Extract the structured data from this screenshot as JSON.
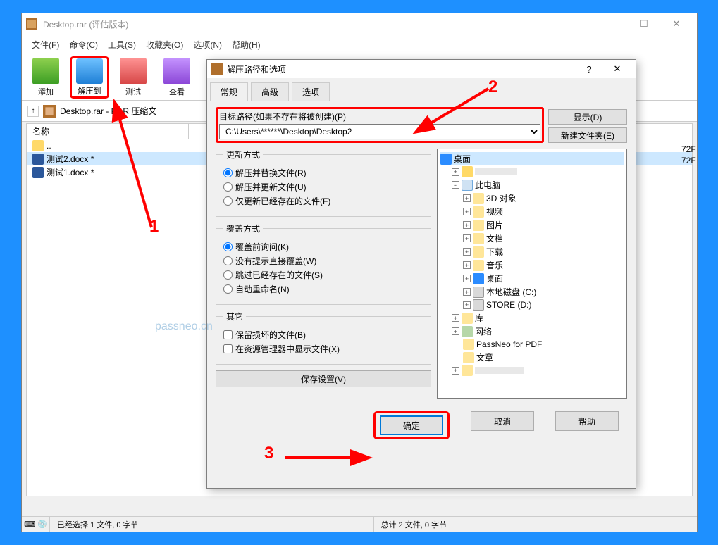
{
  "window": {
    "title": "Desktop.rar (评估版本)",
    "menus": [
      "文件(F)",
      "命令(C)",
      "工具(S)",
      "收藏夹(O)",
      "选项(N)",
      "帮助(H)"
    ],
    "toolbar": {
      "add": "添加",
      "extract_to": "解压到",
      "test": "测试",
      "view": "查看"
    },
    "path": "Desktop.rar - RAR 压缩文",
    "list_header": "名称",
    "files": [
      {
        "name": "..",
        "type": "up"
      },
      {
        "name": "测试2.docx *",
        "type": "docx"
      },
      {
        "name": "测试1.docx *",
        "type": "docx"
      }
    ],
    "right_vals": [
      "72F",
      "72F"
    ],
    "status_left": "已经选择 1 文件, 0 字节",
    "status_right": "总计 2 文件, 0 字节"
  },
  "dialog": {
    "title": "解压路径和选项",
    "tabs": [
      "常规",
      "高级",
      "选项"
    ],
    "path_label": "目标路径(如果不存在将被创建)(P)",
    "path_value": "C:\\Users\\******\\Desktop\\Desktop2",
    "btn_show": "显示(D)",
    "btn_newfolder": "新建文件夹(E)",
    "update": {
      "legend": "更新方式",
      "opts": [
        "解压并替换文件(R)",
        "解压并更新文件(U)",
        "仅更新已经存在的文件(F)"
      ]
    },
    "overwrite": {
      "legend": "覆盖方式",
      "opts": [
        "覆盖前询问(K)",
        "没有提示直接覆盖(W)",
        "跳过已经存在的文件(S)",
        "自动重命名(N)"
      ]
    },
    "other": {
      "legend": "其它",
      "opts": [
        "保留损坏的文件(B)",
        "在资源管理器中显示文件(X)"
      ]
    },
    "save": "保存设置(V)",
    "tree": {
      "root": "桌面",
      "items": [
        {
          "label": "此电脑",
          "icon": "pc",
          "indent": 1,
          "exp": "-"
        },
        {
          "label": "3D 对象",
          "icon": "fold",
          "indent": 2,
          "exp": "+"
        },
        {
          "label": "视频",
          "icon": "fold",
          "indent": 2,
          "exp": "+"
        },
        {
          "label": "图片",
          "icon": "fold",
          "indent": 2,
          "exp": "+"
        },
        {
          "label": "文档",
          "icon": "fold",
          "indent": 2,
          "exp": "+"
        },
        {
          "label": "下载",
          "icon": "fold",
          "indent": 2,
          "exp": "+"
        },
        {
          "label": "音乐",
          "icon": "fold",
          "indent": 2,
          "exp": "+"
        },
        {
          "label": "桌面",
          "icon": "desk",
          "indent": 2,
          "exp": "+"
        },
        {
          "label": "本地磁盘 (C:)",
          "icon": "drive",
          "indent": 2,
          "exp": "+"
        },
        {
          "label": "STORE (D:)",
          "icon": "drive",
          "indent": 2,
          "exp": "+"
        },
        {
          "label": "库",
          "icon": "fold",
          "indent": 1,
          "exp": "+"
        },
        {
          "label": "网络",
          "icon": "net",
          "indent": 1,
          "exp": "+"
        },
        {
          "label": "PassNeo for PDF",
          "icon": "fold",
          "indent": 1,
          "exp": ""
        },
        {
          "label": "文章",
          "icon": "fold",
          "indent": 1,
          "exp": ""
        }
      ]
    },
    "footer": {
      "ok": "确定",
      "cancel": "取消",
      "help": "帮助"
    }
  },
  "anno": {
    "n1": "1",
    "n2": "2",
    "n3": "3"
  },
  "watermark": "passneo.cn"
}
